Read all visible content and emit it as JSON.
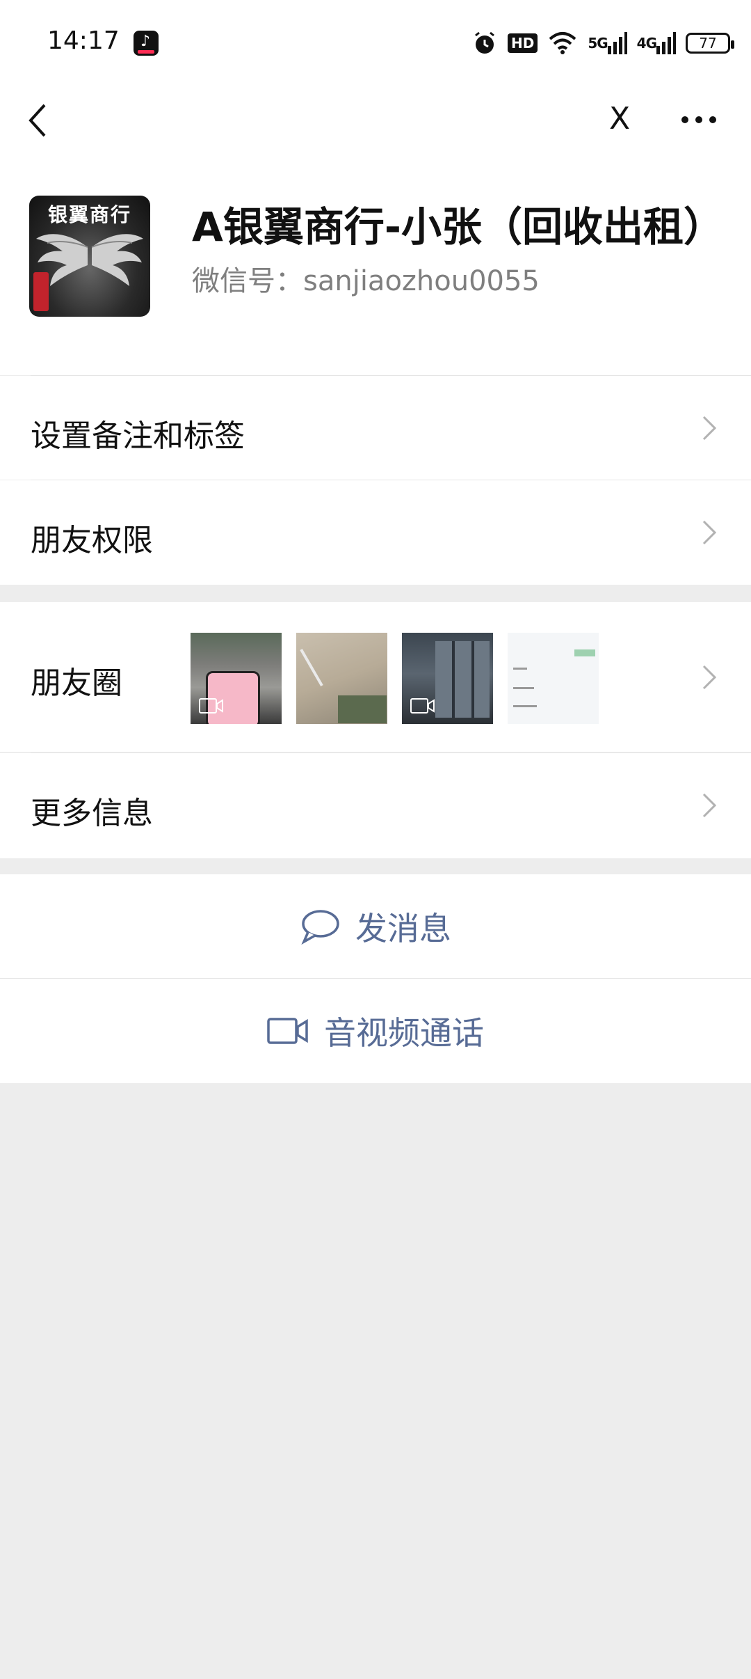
{
  "status_bar": {
    "time": "14:17",
    "battery": "77",
    "network_5g": "5G",
    "network_4g": "4G",
    "hd_badge": "HD"
  },
  "nav": {
    "close_label": "X"
  },
  "profile": {
    "name": "A银翼商行-小张（回收出租）",
    "wechat_id": "微信号：sanjiaozhou0055",
    "avatar_text": "银翼商行"
  },
  "menu": {
    "remark": "设置备注和标签",
    "permissions": "朋友权限",
    "moments": "朋友圈",
    "more_info": "更多信息"
  },
  "actions": {
    "message": "发消息",
    "video_call": "音视频通话"
  },
  "colors": {
    "link_blue": "#576b95",
    "background_gray": "#ededed"
  }
}
